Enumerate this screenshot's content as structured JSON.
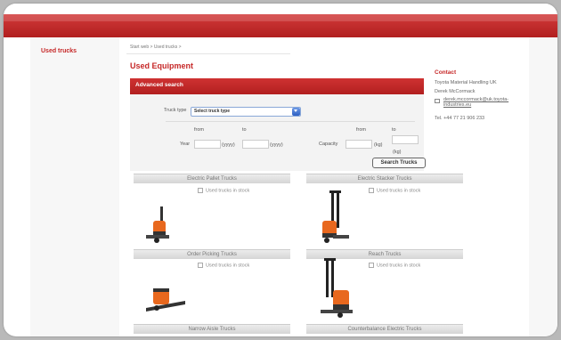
{
  "sidebar": {
    "used_trucks_link": "Used trucks"
  },
  "breadcrumb": "Start web > Used trucks >",
  "page_title": "Used Equipment",
  "advanced_search": {
    "title": "Advanced search",
    "truck_type_label": "Truck type",
    "truck_type_value": "Select truck type",
    "year": {
      "from_label": "from",
      "to_label": "to",
      "label": "Year",
      "unit_from": "(yyyy)",
      "unit_to": "(yyyy)"
    },
    "capacity": {
      "from_label": "from",
      "to_label": "to",
      "label": "Capacity",
      "unit_from": "(kg)",
      "unit_to": "(kg)"
    },
    "search_button": "Search Trucks"
  },
  "contact": {
    "title": "Contact",
    "company": "Toyota Material Handling UK",
    "name": "Derek McCormack",
    "email": "derek.mccormack@uk.toyota-industries.eu",
    "tel": "Tel. +44 77 21 906 233"
  },
  "categories": [
    {
      "title": "Electric Pallet Trucks",
      "link": "Used trucks in stock",
      "icon": "pallet-truck"
    },
    {
      "title": "Electric Stacker Trucks",
      "link": "Used trucks in stock",
      "icon": "stacker-truck"
    },
    {
      "title": "Order Picking Trucks",
      "link": "Used trucks in stock",
      "icon": "order-picker"
    },
    {
      "title": "Reach Trucks",
      "link": "Used trucks in stock",
      "icon": "reach-truck"
    },
    {
      "title": "Narrow Aisle Trucks",
      "link": "",
      "icon": ""
    },
    {
      "title": "Counterbalance Electric Trucks",
      "link": "",
      "icon": ""
    }
  ],
  "colors": {
    "brand_red": "#c62828",
    "band_red": "#c02a2a"
  }
}
